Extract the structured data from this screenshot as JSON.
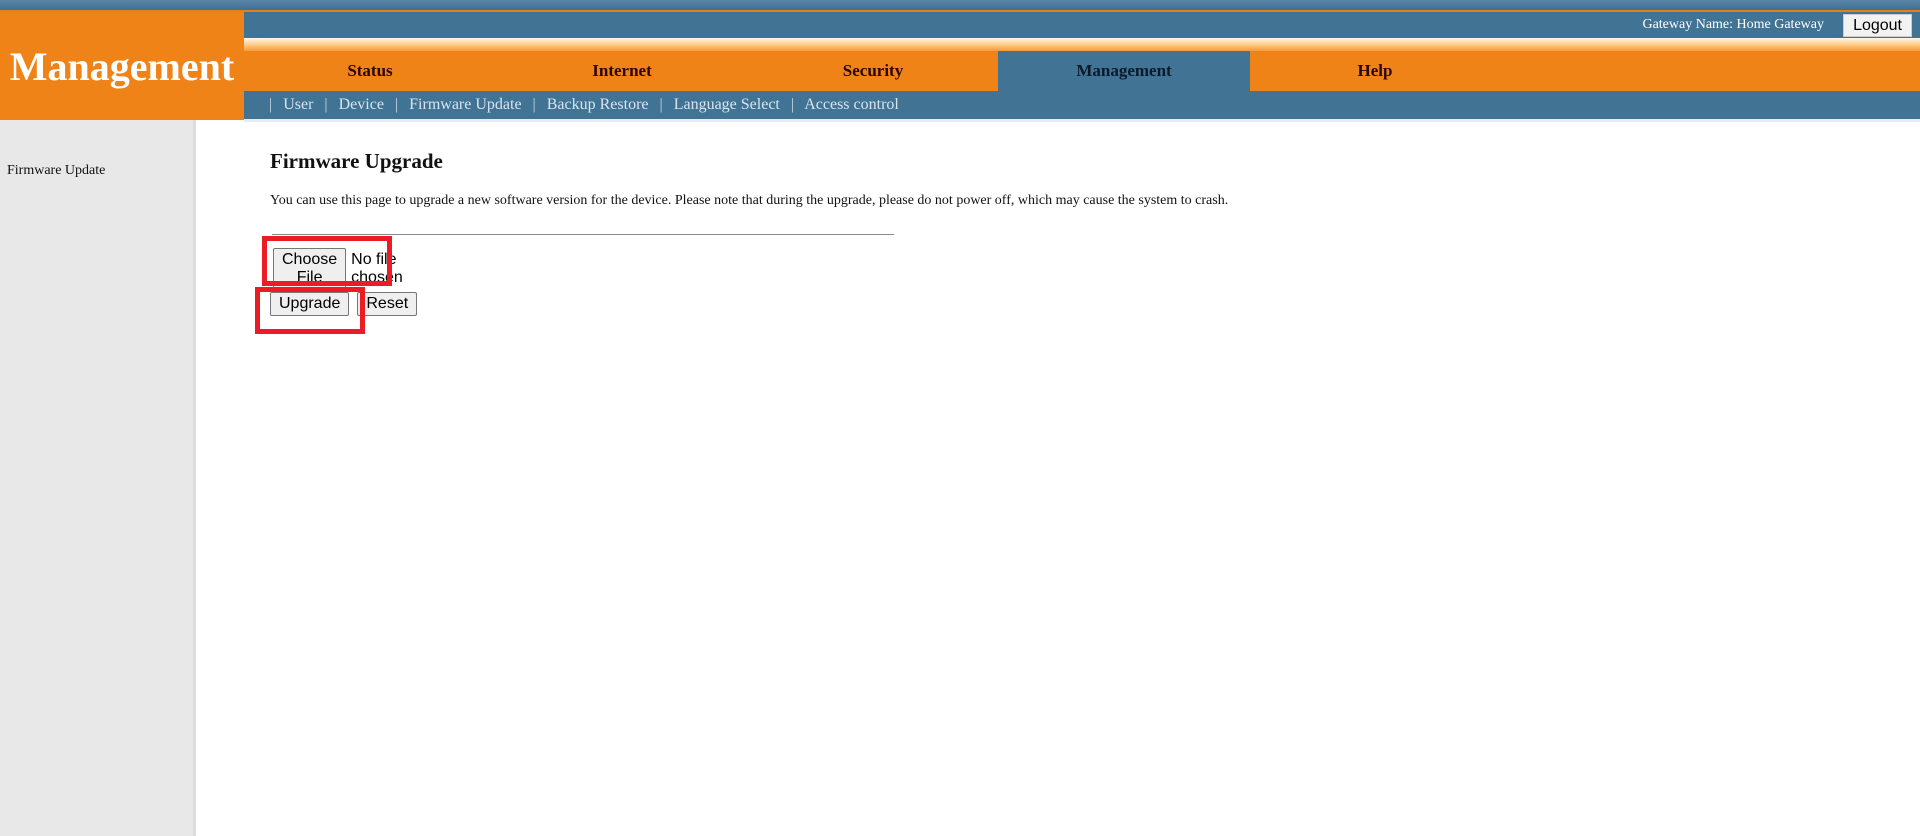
{
  "header": {
    "logo_title": "Management",
    "gateway_name_label": "Gateway Name: Home Gateway",
    "logout_label": "Logout"
  },
  "tabs": [
    {
      "label": "Status",
      "active": false
    },
    {
      "label": "Internet",
      "active": false
    },
    {
      "label": "Security",
      "active": false
    },
    {
      "label": "Management",
      "active": true
    },
    {
      "label": "Help",
      "active": false
    }
  ],
  "submenu": [
    {
      "label": "User"
    },
    {
      "label": "Device"
    },
    {
      "label": "Firmware Update"
    },
    {
      "label": "Backup Restore"
    },
    {
      "label": "Language Select"
    },
    {
      "label": "Access control"
    }
  ],
  "submenu_separator": "|",
  "sidebar": {
    "items": [
      {
        "label": "Firmware Update"
      }
    ]
  },
  "main": {
    "title": "Firmware Upgrade",
    "description": "You can use this page to upgrade a new software version for the device. Please note that during the upgrade, please do not power off, which may cause the system to crash.",
    "file_input": {
      "button_label": "Choose File",
      "status": "No file chosen"
    },
    "upgrade_label": "Upgrade",
    "reset_label": "Reset"
  },
  "colors": {
    "brand_orange": "#ef8317",
    "brand_blue": "#417394",
    "highlight_red": "#ec1c24",
    "sidebar_gray": "#e8e8e8"
  }
}
